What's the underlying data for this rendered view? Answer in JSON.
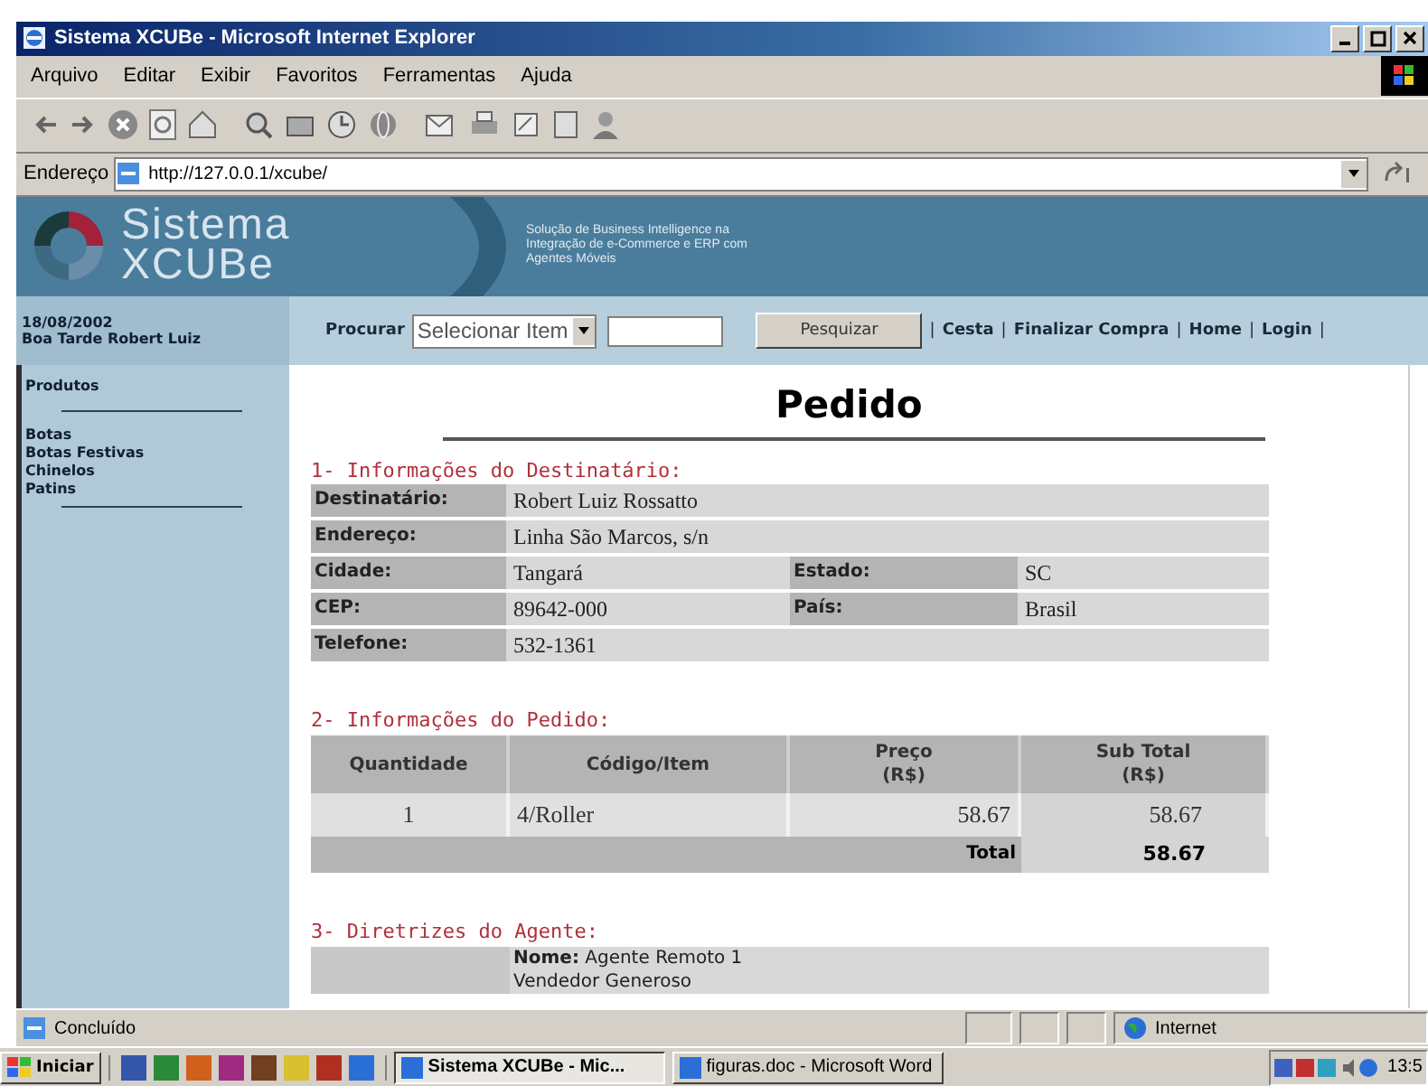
{
  "window": {
    "title": "Sistema XCUBe - Microsoft Internet Explorer"
  },
  "menu": [
    "Arquivo",
    "Editar",
    "Exibir",
    "Favoritos",
    "Ferramentas",
    "Ajuda"
  ],
  "address": {
    "label": "Endereço",
    "url": "http://127.0.0.1/xcube/"
  },
  "banner": {
    "logo_lines": [
      "Sistema",
      "XCUBe"
    ],
    "tagline": [
      "Solução de Business Intelligence na",
      "Integração de e-Commerce e ERP com",
      "Agentes Móveis"
    ]
  },
  "sidebar": {
    "date": "18/08/2002",
    "greeting": "Boa Tarde Robert Luiz",
    "heading": "Produtos",
    "items": [
      "Botas",
      "Botas Festivas",
      "Chinelos",
      "Patins"
    ]
  },
  "nav": {
    "search_label": "Procurar",
    "select_value": "Selecionar Item",
    "button": "Pesquizar",
    "separator": "|",
    "links": [
      "Cesta",
      "Finalizar Compra",
      "Home",
      "Login"
    ]
  },
  "page": {
    "title": "Pedido",
    "recipient": {
      "title": "1- Informações do Destinatário:",
      "rows": [
        {
          "cells": [
            {
              "label": "Destinatário:",
              "value": "Robert Luiz Rossatto"
            }
          ]
        },
        {
          "cells": [
            {
              "label": "Endereço:",
              "value": "Linha São Marcos, s/n"
            }
          ]
        },
        {
          "cells": [
            {
              "label": "Cidade:",
              "value": "Tangará"
            },
            {
              "label": "Estado:",
              "value": "SC"
            }
          ]
        },
        {
          "cells": [
            {
              "label": "CEP:",
              "value": "89642-000"
            },
            {
              "label": "País:",
              "value": "Brasil"
            }
          ]
        },
        {
          "cells": [
            {
              "label": "Telefone:",
              "value": "532-1361"
            }
          ]
        }
      ]
    },
    "order": {
      "title": "2- Informações do Pedido:",
      "columns": [
        "Quantidade",
        "Código/Item",
        "Preço\n(R$)",
        "Sub Total\n(R$)"
      ],
      "rows": [
        [
          "1",
          "4/Roller",
          "58.67",
          "58.67"
        ]
      ],
      "total_label": "Total",
      "total_value": "58.67"
    },
    "agent": {
      "title": "3- Diretrizes do Agente:",
      "name_label": "Nome:",
      "name_value": "Agente Remoto 1",
      "line_2": "Vendedor Generoso"
    }
  },
  "status_bar": {
    "text": "Concluído",
    "zone": "Internet"
  },
  "taskbar": {
    "start": "Iniciar",
    "tasks": [
      {
        "label": "Sistema XCUBe - Mic...",
        "selected": true
      },
      {
        "label": "figuras.doc - Microsoft Word",
        "selected": false
      }
    ],
    "clock": "13:5"
  }
}
